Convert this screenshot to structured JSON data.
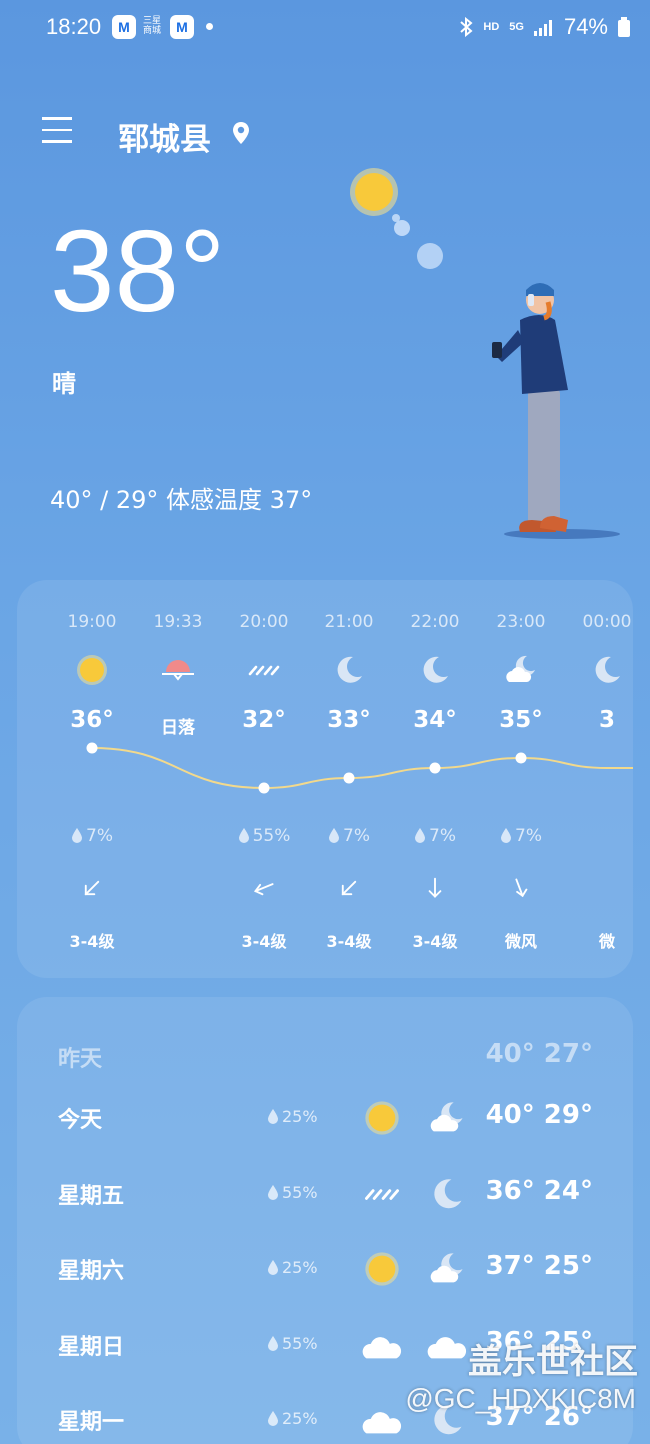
{
  "status_bar": {
    "time": "18:20",
    "badge_m": "M",
    "badge_text": "三星商城",
    "hd": "HD",
    "network": "5G",
    "battery": "74%"
  },
  "header": {
    "location": "郓城县"
  },
  "current": {
    "temperature": "38°",
    "condition": "晴",
    "range_feels": "40° / 29° 体感温度 37°"
  },
  "hourly": [
    {
      "time": "19:00",
      "icon": "sun-icon",
      "temp": "36°",
      "rain": "7%",
      "wind_dir": "down-left-arrow-icon",
      "wind": "3-4级",
      "chart_temp": 36
    },
    {
      "time": "19:33",
      "icon": "sunset-icon",
      "temp": "日落",
      "rain": "",
      "wind_dir": "",
      "wind": "",
      "chart_temp": null
    },
    {
      "time": "20:00",
      "icon": "rain-icon",
      "temp": "32°",
      "rain": "55%",
      "wind_dir": "left-arrow-icon",
      "wind": "3-4级",
      "chart_temp": 32
    },
    {
      "time": "21:00",
      "icon": "moon-icon",
      "temp": "33°",
      "rain": "7%",
      "wind_dir": "down-left-arrow-icon",
      "wind": "3-4级",
      "chart_temp": 33
    },
    {
      "time": "22:00",
      "icon": "moon-icon",
      "temp": "34°",
      "rain": "7%",
      "wind_dir": "down-arrow-icon",
      "wind": "3-4级",
      "chart_temp": 34
    },
    {
      "time": "23:00",
      "icon": "moon-cloud-icon",
      "temp": "35°",
      "rain": "7%",
      "wind_dir": "down-right-arrow-icon",
      "wind": "微风",
      "chart_temp": 35
    },
    {
      "time": "00:00",
      "icon": "moon-icon",
      "temp": "3",
      "rain": "",
      "wind_dir": "",
      "wind": "微",
      "chart_temp": 34
    }
  ],
  "daily": [
    {
      "day": "昨天",
      "rain": "",
      "icon_day": "",
      "icon_night": "",
      "hilo": "40° 27°",
      "dim": true
    },
    {
      "day": "今天",
      "rain": "25%",
      "icon_day": "sun-icon",
      "icon_night": "moon-cloud-icon",
      "hilo": "40° 29°",
      "dim": false
    },
    {
      "day": "星期五",
      "rain": "55%",
      "icon_day": "rain-icon",
      "icon_night": "moon-icon",
      "hilo": "36° 24°",
      "dim": false
    },
    {
      "day": "星期六",
      "rain": "25%",
      "icon_day": "sun-icon",
      "icon_night": "moon-cloud-icon",
      "hilo": "37° 25°",
      "dim": false
    },
    {
      "day": "星期日",
      "rain": "55%",
      "icon_day": "cloud-icon",
      "icon_night": "cloud-icon",
      "hilo": "36° 25°",
      "dim": false
    },
    {
      "day": "星期一",
      "rain": "25%",
      "icon_day": "cloud-icon",
      "icon_night": "moon-icon",
      "hilo": "37° 26°",
      "dim": false
    }
  ],
  "watermark": {
    "line1": "盖乐世社区",
    "line2": "@GC_HDXKIC8M"
  },
  "colors": {
    "sun": "#f8c93a",
    "sunset": "#f08a8a",
    "temp_line": "#f2d98c",
    "background_top": "#5b97df"
  }
}
